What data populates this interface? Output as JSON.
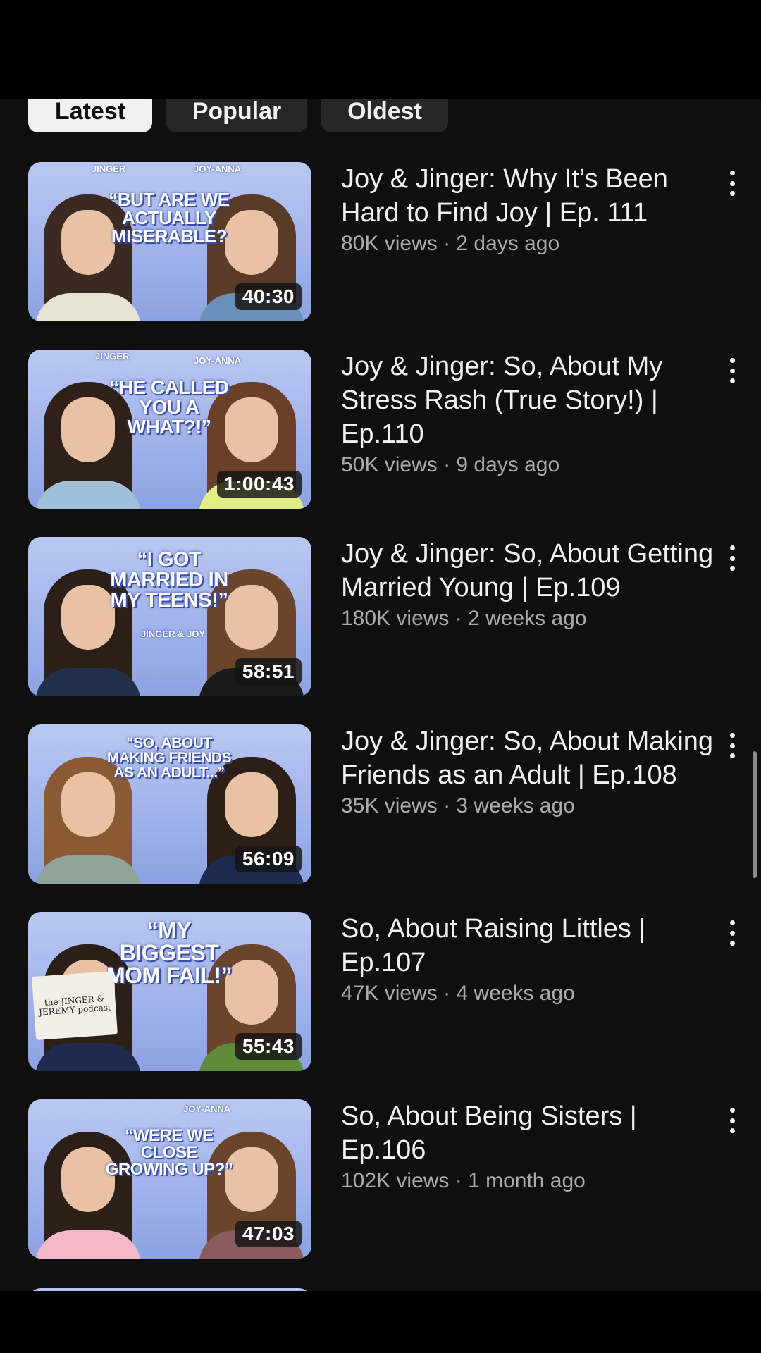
{
  "filters": {
    "latest": "Latest",
    "popular": "Popular",
    "oldest": "Oldest"
  },
  "videos": [
    {
      "title": "Joy & Jinger: Why It’s Been Hard to Find Joy | Ep. 111",
      "meta": "80K views · 2 days ago",
      "duration": "40:30",
      "thumb_text": "“BUT ARE WE ACTUALLY MISERABLE?",
      "tag_left": "JINGER",
      "tag_right": "JOY-ANNA"
    },
    {
      "title": "Joy & Jinger: So, About My Stress Rash (True Story!) | Ep.110",
      "meta": "50K views · 9 days ago",
      "duration": "1:00:43",
      "thumb_text": "“HE CALLED YOU A WHAT?!”",
      "tag_left": "JINGER",
      "tag_right": "JOY-ANNA"
    },
    {
      "title": "Joy & Jinger: So, About Getting Married Young | Ep.109",
      "meta": "180K views · 2 weeks ago",
      "duration": "58:51",
      "thumb_text": "“I GOT MARRIED IN MY TEENS!”",
      "tag_left": "",
      "tag_right": "JINGER & JOY"
    },
    {
      "title": "Joy & Jinger: So, About Making Friends as an Adult | Ep.108",
      "meta": "35K views · 3 weeks ago",
      "duration": "56:09",
      "thumb_text": "“SO, ABOUT MAKING FRIENDS AS AN ADULT...”",
      "tag_left": "",
      "tag_right": ""
    },
    {
      "title": "So, About Raising Littles | Ep.107",
      "meta": "47K views · 4 weeks ago",
      "duration": "55:43",
      "thumb_text": "“MY BIGGEST MOM FAIL!”",
      "tag_left": "",
      "tag_right": "",
      "card_text": "the JINGER & JEREMY podcast"
    },
    {
      "title": "So, About Being Sisters | Ep.106",
      "meta": "102K views · 1 month ago",
      "duration": "47:03",
      "thumb_text": "“WERE WE CLOSE GROWING UP?”",
      "tag_left": "",
      "tag_right": "JOY-ANNA"
    }
  ]
}
